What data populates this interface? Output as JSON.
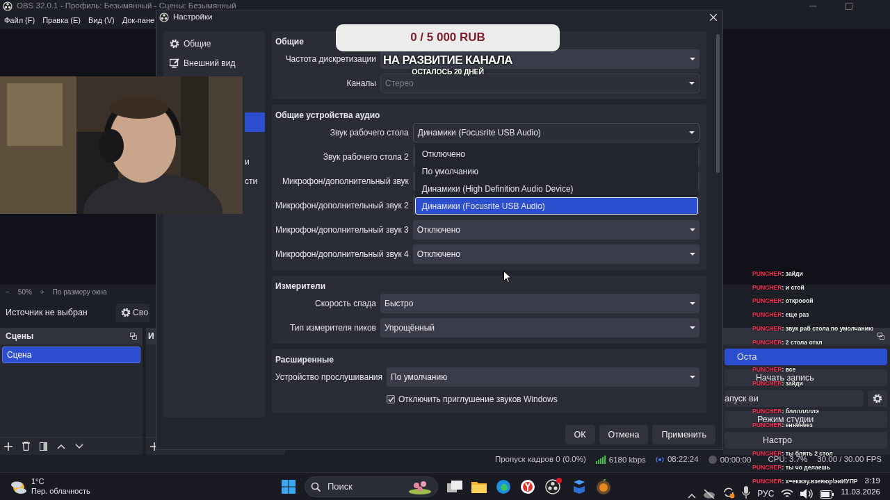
{
  "main_window": {
    "title": "OBS 32.0.1 - Профиль: Безымянный - Сцены: Безымянный"
  },
  "menu": [
    "Файл (F)",
    "Правка (E)",
    "Вид (V)",
    "Док-пане"
  ],
  "zoom_bar": {
    "minus": "−",
    "zoom": "50%",
    "plus": "+",
    "fit": "По размеру окна"
  },
  "source_bar": {
    "label": "Источник не выбран",
    "button": "Сво"
  },
  "scenes_dock": {
    "title": "Сцены",
    "items": [
      {
        "label": "Сцена",
        "selected": true
      }
    ]
  },
  "sources_dock": {
    "title": "И"
  },
  "controls_dock": {
    "buttons": [
      {
        "label": "Оста",
        "kind": "primary"
      },
      {
        "label": "Начать запись",
        "kind": "plain"
      },
      {
        "label": "апуск ви",
        "kind": "split"
      },
      {
        "label": "Режим студии",
        "kind": "plain"
      },
      {
        "label": "Настро",
        "kind": "plain"
      }
    ]
  },
  "status_bar": {
    "dropped": "Пропуск кадров 0 (0.0%)",
    "bitrate": "6180 kbps",
    "stream_time": "08:22:24",
    "record_time": "00:00:00",
    "cpu": "CPU: 3.7%",
    "fps": "30.00 / 30.00 FPS"
  },
  "dialog": {
    "title": "Настройки",
    "sidebar": [
      {
        "kind": "full",
        "label": "Общие",
        "selected": false
      },
      {
        "kind": "full",
        "label": "Внешний вид",
        "selected": false
      },
      {
        "kind": "hidden",
        "selected": false
      },
      {
        "kind": "hidden",
        "selected": false
      },
      {
        "kind": "hidden",
        "selected": true
      },
      {
        "kind": "hidden",
        "selected": false
      },
      {
        "kind": "tail",
        "label": "и",
        "selected": false
      },
      {
        "kind": "tail",
        "label": "сти",
        "selected": false
      }
    ],
    "sections": [
      {
        "title": "Общие",
        "rows": [
          {
            "kind": "select",
            "label": "Частота дискретизации",
            "disabled": false
          },
          {
            "kind": "select",
            "label": "Каналы",
            "value": "Стерео",
            "disabled": true
          }
        ]
      },
      {
        "title": "Общие устройства аудио",
        "rows": [
          {
            "kind": "select",
            "label": "Звук рабочего стола",
            "value": "Динамики (Focusrite USB Audio)",
            "disabled": false,
            "expanded": true,
            "options": [
              {
                "label": "Отключено",
                "selected": false
              },
              {
                "label": "По умолчанию",
                "selected": false
              },
              {
                "label": "Динамики (High Definition Audio Device)",
                "selected": false
              },
              {
                "label": "Динамики (Focusrite USB Audio)",
                "selected": true
              }
            ]
          },
          {
            "kind": "select",
            "label": "Звук рабочего стола 2",
            "disabled": false
          },
          {
            "kind": "select",
            "label": "Микрофон/дополнительный звук",
            "disabled": false
          },
          {
            "kind": "select",
            "label": "Микрофон/дополнительный звук 2",
            "disabled": false
          },
          {
            "kind": "select",
            "label": "Микрофон/дополнительный звук 3",
            "value": "Отключено",
            "disabled": false
          },
          {
            "kind": "select",
            "label": "Микрофон/дополнительный звук 4",
            "value": "Отключено",
            "disabled": false
          }
        ]
      },
      {
        "title": "Измерители",
        "rows": [
          {
            "kind": "select",
            "label": "Скорость спада",
            "value": "Быстро",
            "disabled": false
          },
          {
            "kind": "select",
            "label": "Тип измерителя пиков",
            "value": "Упрощённый",
            "disabled": false
          }
        ]
      },
      {
        "title": "Расширенные",
        "rows": [
          {
            "kind": "select",
            "label": "Устройство прослушивания",
            "value": "По умолчанию",
            "disabled": false
          },
          {
            "kind": "checkbox",
            "label": "Отключить приглушение звуков Windows",
            "checked": true
          }
        ]
      }
    ],
    "buttons": [
      "ОК",
      "Отмена",
      "Применить"
    ]
  },
  "donation_overlay": {
    "amount": "0 / 5 000 RUB",
    "goal": "НА РАЗВИТИЕ КАНАЛА",
    "remaining": "ОСТАЛОСЬ 20 ДНЕЙ"
  },
  "webcam": {
    "kind": "picture"
  },
  "chat": {
    "groups": [
      [
        {
          "user": "PUNCHER",
          "text": ": зайди"
        },
        {
          "user": "PUNCHER",
          "text": ": и стой"
        },
        {
          "user": "PUNCHER",
          "text": ": открооой"
        },
        {
          "user": "PUNCHER",
          "text": ": еще раз"
        },
        {
          "user": "PUNCHER",
          "text": ": звук раб стола по умолчанию"
        },
        {
          "user": "PUNCHER",
          "text": ": 2 стола откл"
        }
      ],
      [
        {
          "user": "PUNCHER",
          "text": ": все"
        },
        {
          "user": "PUNCHER",
          "text": ": зайди"
        }
      ],
      [
        {
          "user": "PUNCHER",
          "text": ": блллллллэ"
        },
        {
          "user": "PUNCHER",
          "text": ": енненеез"
        }
      ],
      [
        {
          "user": "PUNCHER",
          "text": ": ты блять 2 стол"
        },
        {
          "user": "PUNCHER",
          "text": ": ты чо делаешь"
        },
        {
          "user": "PUNCHER",
          "text": ": х=екжэу.взеяюр\\эиИУПР"
        }
      ]
    ]
  },
  "taskbar": {
    "temperature": "1°C",
    "weather": "Пер. облачность",
    "search": {
      "placeholder": "Поиск"
    },
    "language": "РУС",
    "time": "3:19",
    "date": "11.03.2026"
  }
}
